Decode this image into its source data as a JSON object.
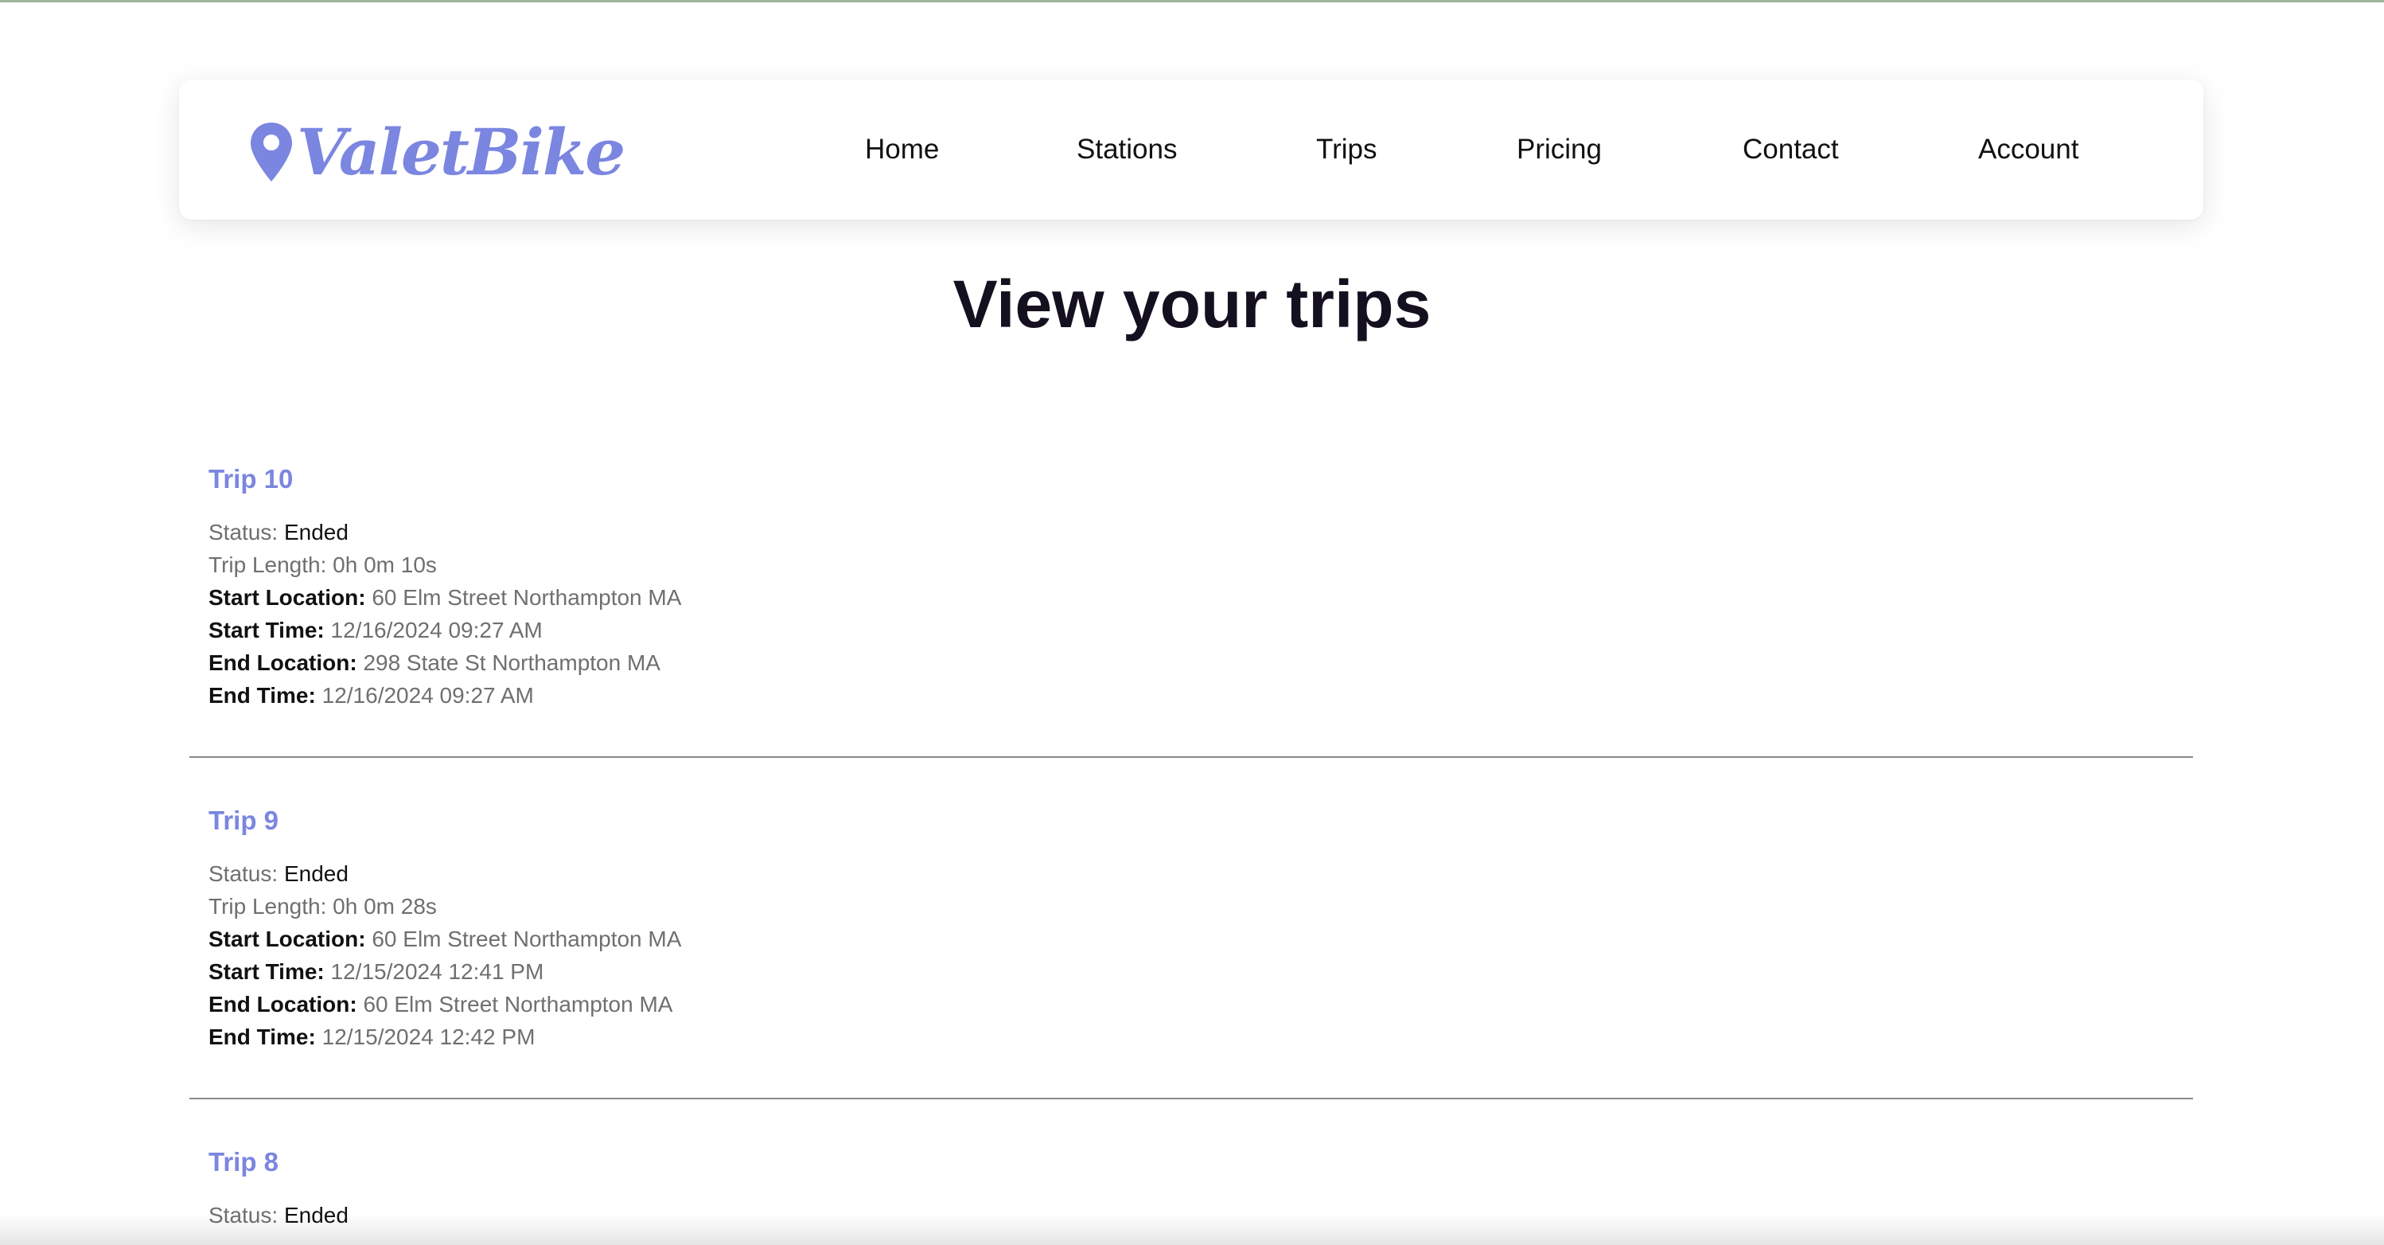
{
  "brand": {
    "name": "ValetBike",
    "color": "#7b86e0"
  },
  "nav": {
    "items": [
      {
        "label": "Home"
      },
      {
        "label": "Stations"
      },
      {
        "label": "Trips"
      },
      {
        "label": "Pricing"
      },
      {
        "label": "Contact"
      },
      {
        "label": "Account"
      }
    ]
  },
  "page": {
    "title": "View your trips"
  },
  "labels": {
    "status": "Status:",
    "trip_length": "Trip Length:",
    "start_location": "Start Location:",
    "start_time": "Start Time:",
    "end_location": "End Location:",
    "end_time": "End Time:"
  },
  "trips": [
    {
      "title": "Trip 10",
      "status": "Ended",
      "trip_length": "0h 0m 10s",
      "start_location": "60 Elm Street Northampton MA",
      "start_time": "12/16/2024 09:27 AM",
      "end_location": "298 State St Northampton MA",
      "end_time": "12/16/2024 09:27 AM"
    },
    {
      "title": "Trip 9",
      "status": "Ended",
      "trip_length": "0h 0m 28s",
      "start_location": "60 Elm Street Northampton MA",
      "start_time": "12/15/2024 12:41 PM",
      "end_location": "60 Elm Street Northampton MA",
      "end_time": "12/15/2024 12:42 PM"
    },
    {
      "title": "Trip 8",
      "status": "Ended"
    }
  ]
}
